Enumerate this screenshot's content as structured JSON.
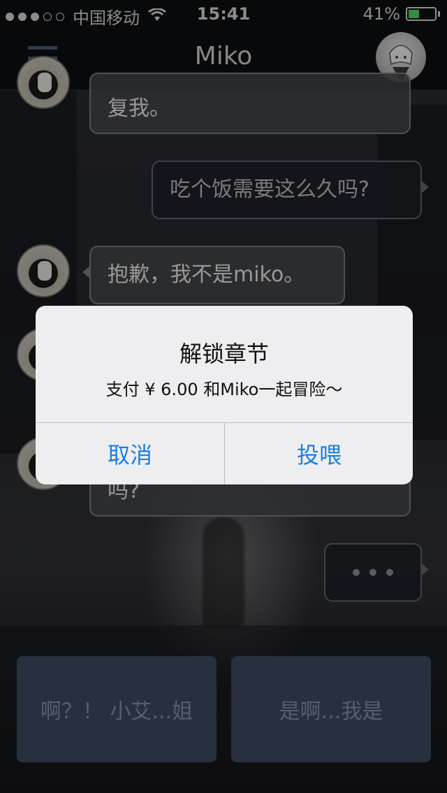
{
  "status_bar": {
    "signal_dots_filled": 3,
    "signal_dots_total": 5,
    "carrier": "中国移动",
    "wifi_icon": "wifi-icon",
    "time": "15:41",
    "battery_percent": "41%",
    "battery_level": 0.41,
    "battery_color": "#4cd964"
  },
  "nav": {
    "menu_icon": "hamburger-menu-icon",
    "title": "Miko",
    "avatar_icon": "miko-avatar"
  },
  "chat": {
    "messages": [
      {
        "sender": "other",
        "text": "复我。"
      },
      {
        "sender": "me",
        "text": "吃个饭需要这么久吗?"
      },
      {
        "sender": "other",
        "text": "抱歉，我不是miko。"
      },
      {
        "sender": "other",
        "text": "吗?"
      },
      {
        "sender": "me",
        "typing": true
      }
    ]
  },
  "options": [
    {
      "label": "啊？！ 小艾...姐"
    },
    {
      "label": "是啊...我是"
    }
  ],
  "alert": {
    "title": "解锁章节",
    "message": "支付 ¥ 6.00 和Miko一起冒险～",
    "cancel_label": "取消",
    "confirm_label": "投喂",
    "button_color": "#1a7ee8"
  }
}
